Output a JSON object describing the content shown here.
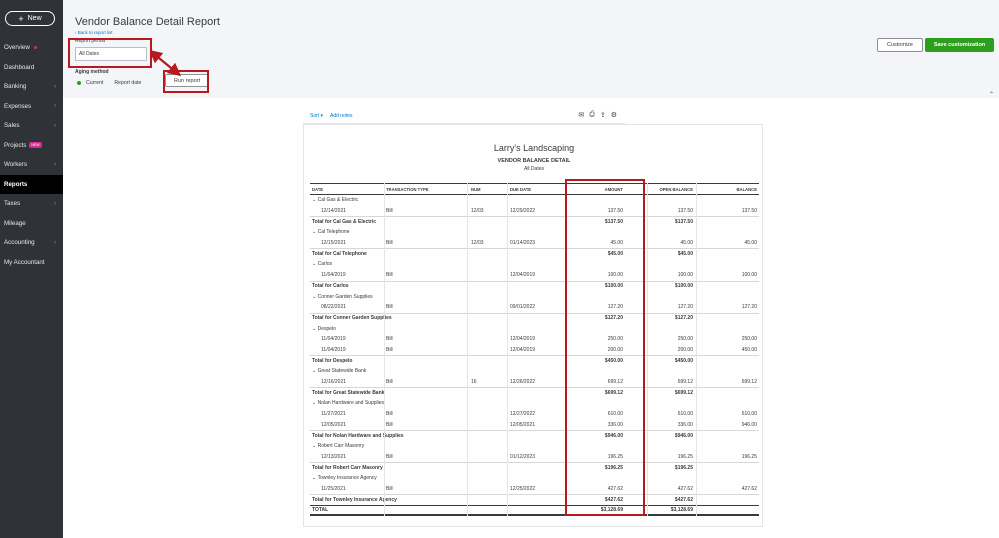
{
  "sidebar": {
    "new_label": "New",
    "items": [
      {
        "label": "Overview",
        "dot": true
      },
      {
        "label": "Banking",
        "chev": true
      },
      {
        "label": "Expenses",
        "chev": true
      },
      {
        "label": "Sales",
        "chev": true
      },
      {
        "label": "Projects",
        "badge": "NEW"
      },
      {
        "label": "Workers",
        "chev": true
      },
      {
        "label": "Reports",
        "active": true
      },
      {
        "label": "Taxes",
        "chev": true
      },
      {
        "label": "Mileage"
      },
      {
        "label": "Accounting",
        "chev": true
      },
      {
        "label": "My Accountant"
      }
    ],
    "dashboard_label": "Dashboard"
  },
  "header": {
    "title": "Vendor Balance Detail Report",
    "back_link": "Back to report list",
    "report_period_label": "Report period",
    "report_period_value": "All Dates",
    "aging_label": "Aging method",
    "aging_current": "Current",
    "aging_report_date": "Report date",
    "run_report": "Run report",
    "customize": "Customize",
    "save_customization": "Save customization"
  },
  "toolbar": {
    "sort": "Sort",
    "add_notes": "Add notes"
  },
  "report": {
    "company": "Larry's Landscaping",
    "title": "VENDOR BALANCE DETAIL",
    "subtitle": "All Dates",
    "columns": [
      "DATE",
      "TRANSACTION TYPE",
      "NUM",
      "DUE DATE",
      "AMOUNT",
      "OPEN BALANCE",
      "BALANCE"
    ],
    "rows": [
      {
        "kind": "group",
        "date": "Cal Gas & Electric"
      },
      {
        "kind": "line",
        "date": "12/14/2021",
        "type": "Bill",
        "num": "12/03",
        "due": "12/29/2022",
        "amount": "137.50",
        "open": "137.50",
        "balance": "137.50"
      },
      {
        "kind": "total",
        "date": "Total for Cal Gas & Electric",
        "amount": "$137.50",
        "open": "$137.50"
      },
      {
        "kind": "group",
        "date": "Cal Telephone"
      },
      {
        "kind": "line",
        "date": "12/15/2021",
        "type": "Bill",
        "num": "12/03",
        "due": "01/14/2023",
        "amount": "45.00",
        "open": "45.00",
        "balance": "45.00"
      },
      {
        "kind": "total",
        "date": "Total for Cal Telephone",
        "amount": "$45.00",
        "open": "$45.00"
      },
      {
        "kind": "group",
        "date": "Carlos"
      },
      {
        "kind": "line",
        "date": "11/04/2019",
        "type": "Bill",
        "num": "",
        "due": "12/04/2019",
        "amount": "100.00",
        "open": "100.00",
        "balance": "100.00"
      },
      {
        "kind": "total",
        "date": "Total for Carlos",
        "amount": "$100.00",
        "open": "$100.00"
      },
      {
        "kind": "group",
        "date": "Conner Garden Supplies"
      },
      {
        "kind": "line",
        "date": "08/22/2021",
        "type": "Bill",
        "num": "",
        "due": "09/01/2022",
        "amount": "127.20",
        "open": "127.20",
        "balance": "127.20"
      },
      {
        "kind": "total",
        "date": "Total for Conner Garden Supplies",
        "amount": "$127.20",
        "open": "$127.20"
      },
      {
        "kind": "group",
        "date": "Despelo"
      },
      {
        "kind": "line",
        "date": "11/04/2019",
        "type": "Bill",
        "num": "",
        "due": "12/04/2019",
        "amount": "250.00",
        "open": "250.00",
        "balance": "250.00"
      },
      {
        "kind": "line",
        "date": "11/04/2019",
        "type": "Bill",
        "num": "",
        "due": "12/04/2019",
        "amount": "200.00",
        "open": "200.00",
        "balance": "450.00"
      },
      {
        "kind": "total",
        "date": "Total for Despelo",
        "amount": "$450.00",
        "open": "$450.00"
      },
      {
        "kind": "group",
        "date": "Great Statewide Bank"
      },
      {
        "kind": "line",
        "date": "12/16/2021",
        "type": "Bill",
        "num": "16",
        "due": "12/26/2022",
        "amount": "699.12",
        "open": "699.12",
        "balance": "699.12"
      },
      {
        "kind": "total",
        "date": "Total for Great Statewide Bank",
        "amount": "$699.12",
        "open": "$699.12"
      },
      {
        "kind": "group",
        "date": "Nolan Hardware and Supplies"
      },
      {
        "kind": "line",
        "date": "11/27/2021",
        "type": "Bill",
        "num": "",
        "due": "12/27/2022",
        "amount": "610.00",
        "open": "610.00",
        "balance": "610.00"
      },
      {
        "kind": "line",
        "date": "12/05/2021",
        "type": "Bill",
        "num": "",
        "due": "12/05/2021",
        "amount": "336.00",
        "open": "336.00",
        "balance": "946.00"
      },
      {
        "kind": "total",
        "date": "Total for Nolan Hardware and Supplies",
        "amount": "$946.00",
        "open": "$946.00"
      },
      {
        "kind": "group",
        "date": "Robert Carr Masonry"
      },
      {
        "kind": "line",
        "date": "12/13/2021",
        "type": "Bill",
        "num": "",
        "due": "01/12/2023",
        "amount": "196.25",
        "open": "196.25",
        "balance": "196.25"
      },
      {
        "kind": "total",
        "date": "Total for Robert Carr Masonry",
        "amount": "$196.25",
        "open": "$196.25"
      },
      {
        "kind": "group",
        "date": "Townley Insurance Agency"
      },
      {
        "kind": "line",
        "date": "11/25/2021",
        "type": "Bill",
        "num": "",
        "due": "12/25/2022",
        "amount": "427.62",
        "open": "427.62",
        "balance": "427.62"
      },
      {
        "kind": "total",
        "date": "Total for Townley Insurance Agency",
        "amount": "$427.62",
        "open": "$427.62"
      },
      {
        "kind": "grand",
        "date": "TOTAL",
        "amount": "$3,128.69",
        "open": "$3,128.69"
      }
    ]
  },
  "colors": {
    "accent_green": "#2ca01c",
    "highlight_red": "#b7191f",
    "sidebar_bg": "#2f3237",
    "link_blue": "#0077c5"
  }
}
